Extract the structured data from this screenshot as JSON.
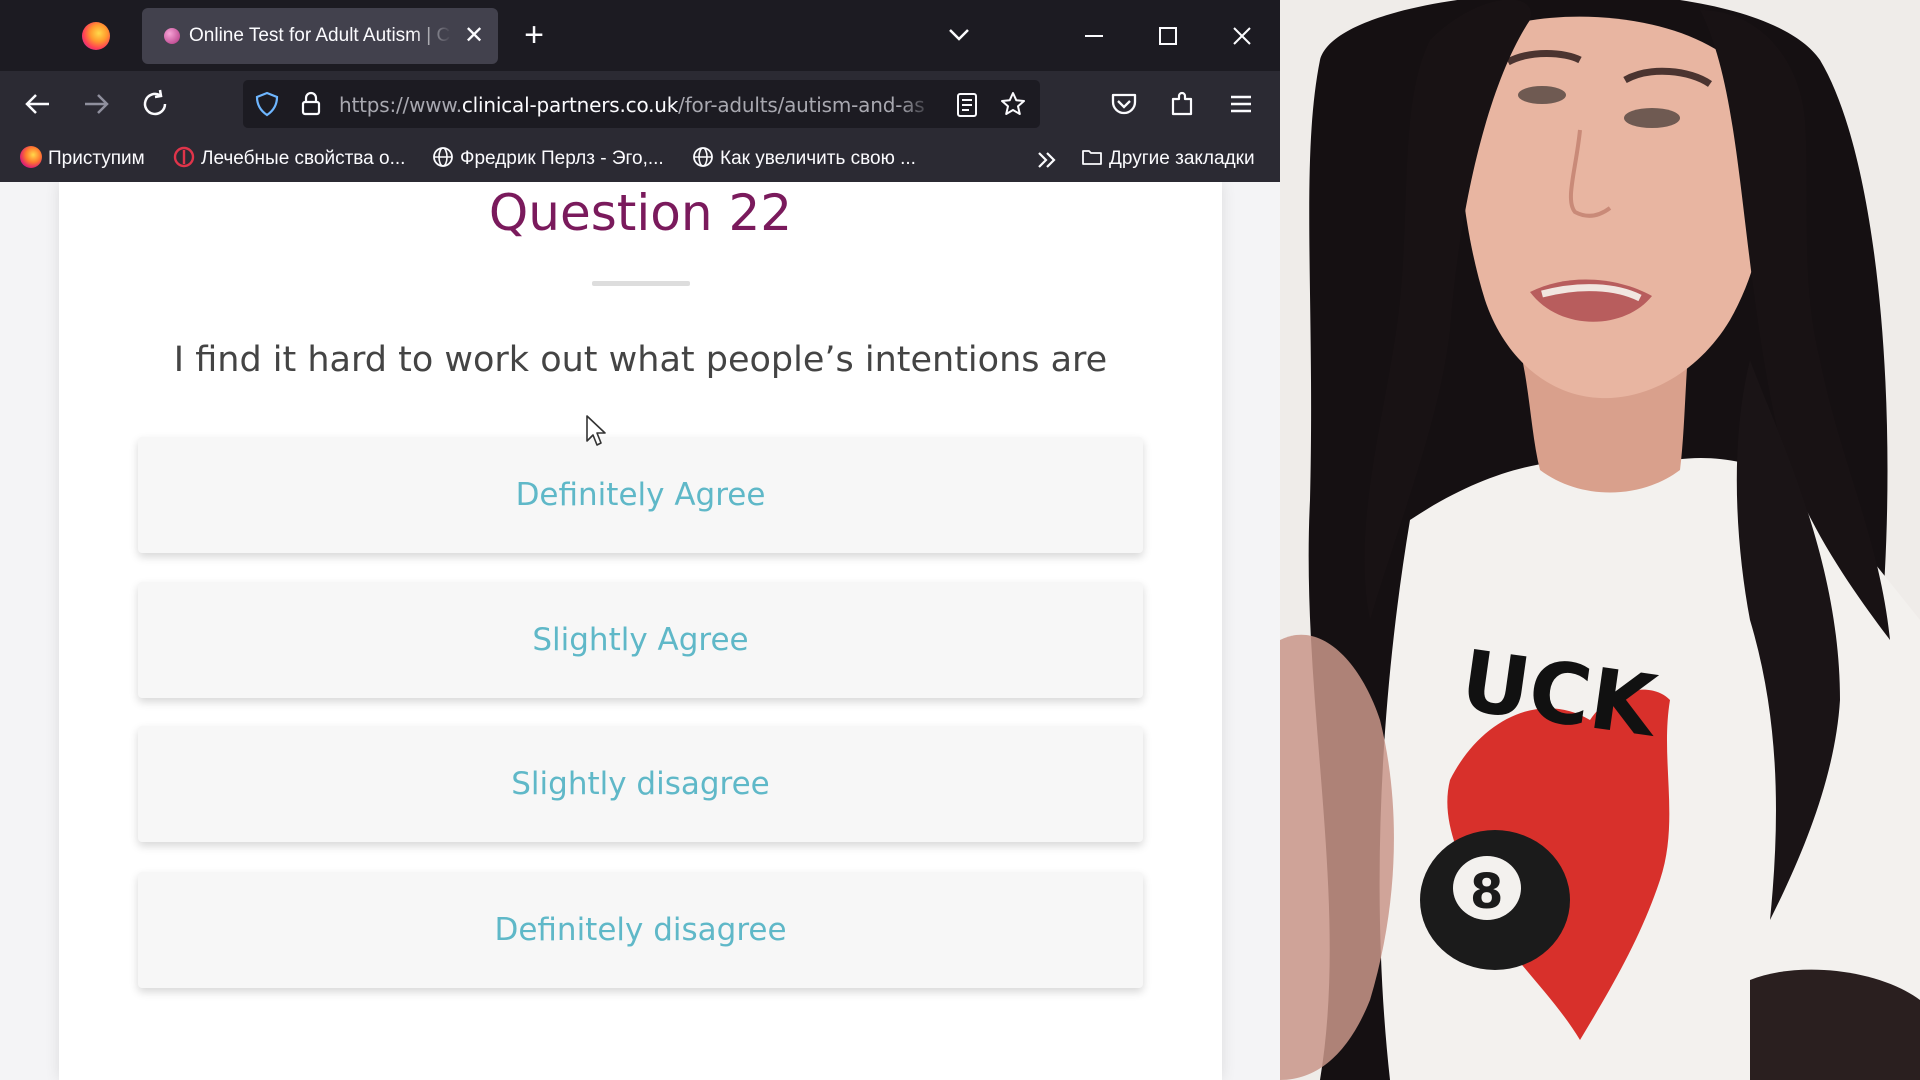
{
  "browser": {
    "tab": {
      "title": "Online Test for Adult Autism | C"
    },
    "url": {
      "prefix": "https://www.",
      "domain": "clinical-partners.co.uk",
      "path": "/for-adults/autism-and-as"
    },
    "bookmarks": [
      {
        "label": "Приступим",
        "icon": "firefox-icon"
      },
      {
        "label": "Лечебные свойства о...",
        "icon": "site-icon"
      },
      {
        "label": "Фредрик Перлз - Эго,...",
        "icon": "globe-icon"
      },
      {
        "label": "Как увеличить свою ...",
        "icon": "globe-icon"
      }
    ],
    "other_bookmarks": "Другие закладки"
  },
  "quiz": {
    "question_title": "Question 22",
    "question_text": "I find it hard to work out what people’s intentions are",
    "answers": [
      "Definitely Agree",
      "Slightly Agree",
      "Slightly disagree",
      "Definitely disagree"
    ],
    "colors": {
      "title": "#7a1a5c",
      "answer_text": "#5fb8c8",
      "question_text": "#444444"
    }
  },
  "webcam": {
    "shirt_text": "UCK",
    "colors": {
      "hair": "#141011",
      "skin": "#e8b5a1",
      "shirt": "#f3f1ee",
      "flame": "#d8302b"
    }
  }
}
